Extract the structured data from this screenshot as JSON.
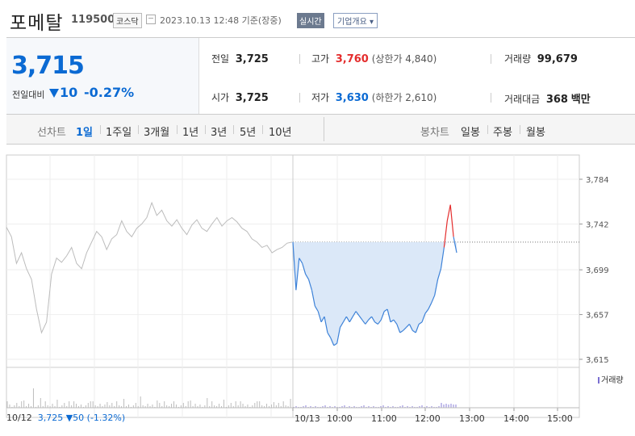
{
  "header": {
    "name": "포메탈",
    "code": "119500",
    "market": "코스닥",
    "timestamp": "2023.10.13 12:48  기준(장중)",
    "realtime": "실시간",
    "corp_info": "기업개요"
  },
  "quote": {
    "price": "3,715",
    "prev_label": "전일대비",
    "change": "10",
    "rate": "-0.27%",
    "prev_close_label": "전일",
    "prev_close": "3,725",
    "high_label": "고가",
    "high": "3,760",
    "upper_limit": "(상한가 4,840)",
    "volume_label": "거래량",
    "volume": "99,679",
    "open_label": "시가",
    "open": "3,725",
    "low_label": "저가",
    "low": "3,630",
    "lower_limit": "(하한가 2,610)",
    "amount_label": "거래대금",
    "amount": "368",
    "amount_unit": "백만"
  },
  "nav": {
    "line_chart": "선차트",
    "periods": [
      "1일",
      "1주일",
      "3개월",
      "1년",
      "3년",
      "5년",
      "10년"
    ],
    "candle_chart": "봉차트",
    "candle_periods": [
      "일봉",
      "주봉",
      "월봉"
    ]
  },
  "volume_legend": "거래량",
  "prev_day_info": {
    "date": "10/12",
    "price": "3,725",
    "change": "▼50",
    "rate": "(-1.32%)"
  },
  "colors": {
    "up": "#e42d2d",
    "down": "#0b6ad3",
    "area": "#dbe8f8",
    "prev": "#bcbcbc"
  },
  "chart_data": {
    "type": "line",
    "y_ticks": [
      "3,784",
      "3,742",
      "3,699",
      "3,657",
      "3,615"
    ],
    "ylim": [
      3615,
      3784
    ],
    "x_ticks": [
      "10/13",
      "10:00",
      "11:00",
      "12:00",
      "13:00",
      "14:00",
      "15:00"
    ],
    "prev_close": 3725,
    "prev_day_series": [
      3739,
      3730,
      3705,
      3715,
      3700,
      3690,
      3662,
      3640,
      3650,
      3695,
      3710,
      3706,
      3712,
      3720,
      3705,
      3700,
      3715,
      3725,
      3735,
      3730,
      3718,
      3728,
      3732,
      3745,
      3735,
      3730,
      3738,
      3742,
      3748,
      3762,
      3750,
      3755,
      3745,
      3740,
      3746,
      3738,
      3732,
      3741,
      3746,
      3738,
      3735,
      3742,
      3748,
      3740,
      3745,
      3748,
      3744,
      3738,
      3735,
      3728,
      3725,
      3720,
      3722,
      3715,
      3718,
      3720,
      3724,
      3725
    ],
    "today_series": [
      3725,
      3680,
      3710,
      3705,
      3695,
      3690,
      3680,
      3665,
      3660,
      3650,
      3655,
      3640,
      3635,
      3628,
      3630,
      3645,
      3650,
      3655,
      3650,
      3655,
      3660,
      3656,
      3652,
      3648,
      3652,
      3655,
      3650,
      3648,
      3652,
      3660,
      3662,
      3650,
      3652,
      3648,
      3640,
      3642,
      3645,
      3648,
      3642,
      3640,
      3648,
      3650,
      3658,
      3662,
      3668,
      3675,
      3690,
      3700,
      3720,
      3745,
      3760,
      3730,
      3715
    ]
  }
}
